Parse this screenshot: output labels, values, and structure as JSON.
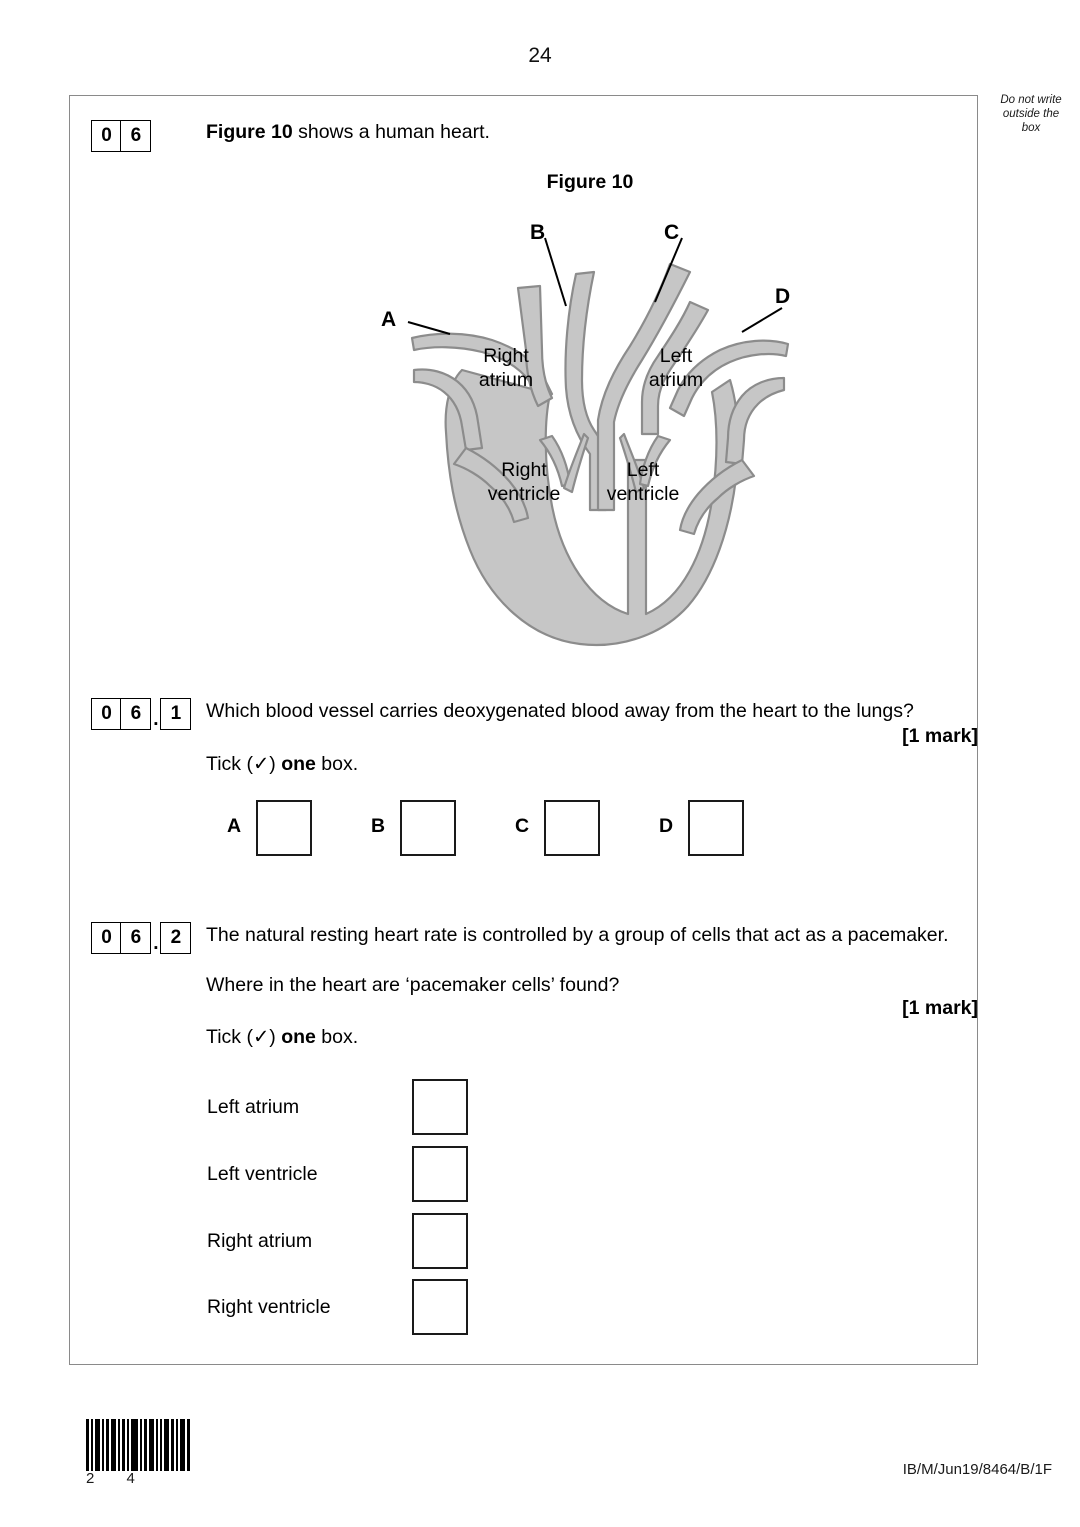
{
  "page": {
    "number": "24",
    "margin_note": "Do not write\noutside the\nbox",
    "margin_note_l1": "Do not write",
    "margin_note_l2": "outside the",
    "margin_note_l3": "box",
    "reference_code": "IB/M/Jun19/8464/B/1F",
    "barcode_digits": "2 4"
  },
  "question": {
    "number_digits": [
      "0",
      "6"
    ],
    "stem_bold": "Figure 10",
    "stem_rest": " shows a human heart.",
    "figure_title": "Figure 10"
  },
  "figure": {
    "title": "Figure 10",
    "vessel_labels": [
      "A",
      "B",
      "C",
      "D"
    ],
    "chamber_labels": [
      {
        "line1": "Right",
        "line2": "atrium"
      },
      {
        "line1": "Left",
        "line2": "atrium"
      },
      {
        "line1": "Right",
        "line2": "ventricle"
      },
      {
        "line1": "Left",
        "line2": "ventricle"
      }
    ],
    "fill_color": "#c6c6c6",
    "stroke_color": "#8c8c8c"
  },
  "part_1": {
    "number_digits": [
      "0",
      "6"
    ],
    "separator": ".",
    "sub_digit": "1",
    "prompt": "Which blood vessel carries deoxygenated blood away from the heart to the lungs?",
    "marks": "[1 mark]",
    "tick_pre": "Tick (",
    "tick_mark": "✓",
    "tick_mid": ") ",
    "tick_bold": "one",
    "tick_post": " box.",
    "options": [
      "A",
      "B",
      "C",
      "D"
    ]
  },
  "part_2": {
    "number_digits": [
      "0",
      "6"
    ],
    "separator": ".",
    "sub_digit": "2",
    "line_1": "The natural resting heart rate is controlled by a group of cells that act as a pacemaker.",
    "line_2": "Where in the heart are ‘pacemaker cells’ found?",
    "marks": "[1 mark]",
    "tick_pre": "Tick (",
    "tick_mark": "✓",
    "tick_mid": ") ",
    "tick_bold": "one",
    "tick_post": " box.",
    "options": [
      "Left atrium",
      "Left ventricle",
      "Right atrium",
      "Right ventricle"
    ]
  }
}
